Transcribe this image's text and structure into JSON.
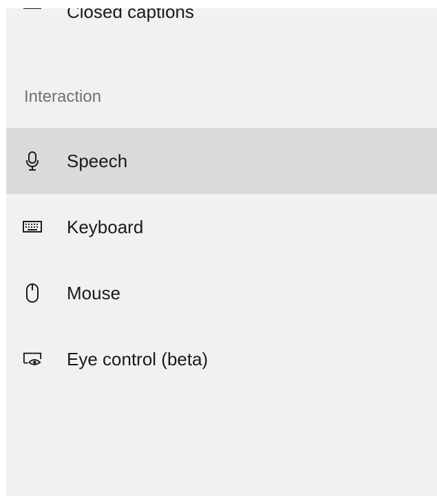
{
  "nav": {
    "above_item": {
      "label": "Closed captions",
      "icon": "closed-captions-icon"
    },
    "section_header": "Interaction",
    "items": [
      {
        "label": "Speech",
        "icon": "microphone-icon",
        "selected": true
      },
      {
        "label": "Keyboard",
        "icon": "keyboard-icon",
        "selected": false
      },
      {
        "label": "Mouse",
        "icon": "mouse-icon",
        "selected": false
      },
      {
        "label": "Eye control (beta)",
        "icon": "eye-control-icon",
        "selected": false
      }
    ]
  },
  "colors": {
    "panel_background": "#f1f1f0",
    "selected_background": "#dadada",
    "accent": "#0063b1",
    "section_header_text": "#707070"
  }
}
